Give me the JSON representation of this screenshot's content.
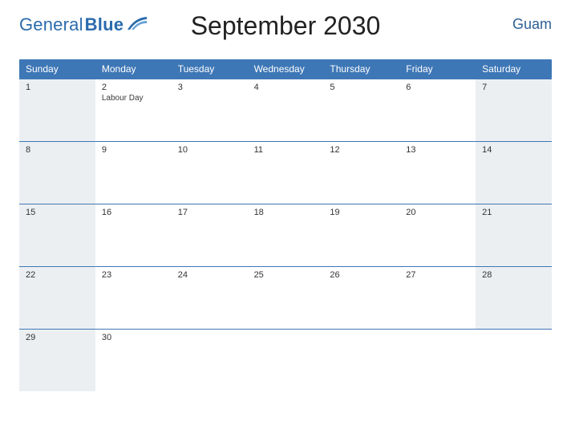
{
  "brand": {
    "word1": "General",
    "word2": "Blue"
  },
  "title": "September 2030",
  "region": "Guam",
  "colors": {
    "accent": "#3e77b6",
    "brand_text": "#2a6bad",
    "shade": "#eceff2"
  },
  "day_headers": [
    "Sunday",
    "Monday",
    "Tuesday",
    "Wednesday",
    "Thursday",
    "Friday",
    "Saturday"
  ],
  "weeks": [
    [
      {
        "n": "1",
        "shade": true
      },
      {
        "n": "2",
        "event": "Labour Day"
      },
      {
        "n": "3"
      },
      {
        "n": "4"
      },
      {
        "n": "5"
      },
      {
        "n": "6"
      },
      {
        "n": "7",
        "shade": true
      }
    ],
    [
      {
        "n": "8",
        "shade": true
      },
      {
        "n": "9"
      },
      {
        "n": "10"
      },
      {
        "n": "11"
      },
      {
        "n": "12"
      },
      {
        "n": "13"
      },
      {
        "n": "14",
        "shade": true
      }
    ],
    [
      {
        "n": "15",
        "shade": true
      },
      {
        "n": "16"
      },
      {
        "n": "17"
      },
      {
        "n": "18"
      },
      {
        "n": "19"
      },
      {
        "n": "20"
      },
      {
        "n": "21",
        "shade": true
      }
    ],
    [
      {
        "n": "22",
        "shade": true
      },
      {
        "n": "23"
      },
      {
        "n": "24"
      },
      {
        "n": "25"
      },
      {
        "n": "26"
      },
      {
        "n": "27"
      },
      {
        "n": "28",
        "shade": true
      }
    ],
    [
      {
        "n": "29",
        "shade": true
      },
      {
        "n": "30"
      },
      {
        "empty": true
      },
      {
        "empty": true
      },
      {
        "empty": true
      },
      {
        "empty": true
      },
      {
        "empty": true
      }
    ]
  ]
}
